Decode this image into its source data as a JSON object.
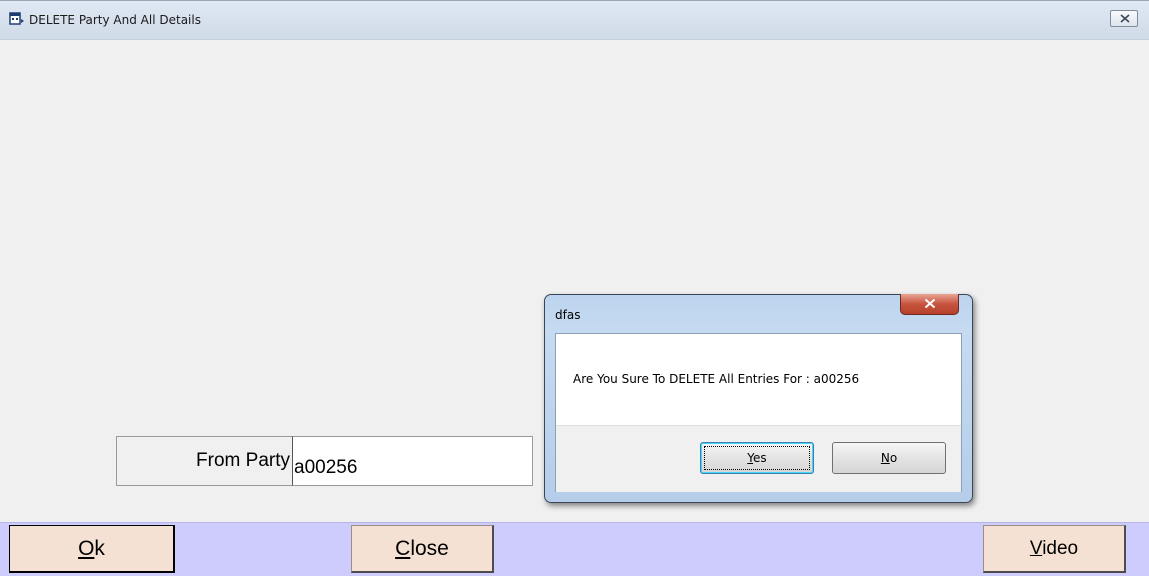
{
  "window": {
    "title": "DELETE Party And All Details"
  },
  "form": {
    "from_party_label": "From Party",
    "from_party_value": "a00256"
  },
  "buttons": {
    "ok": {
      "accel": "O",
      "rest": "k"
    },
    "close": {
      "accel": "C",
      "rest": "lose"
    },
    "video": {
      "accel": "V",
      "rest": "ideo"
    }
  },
  "dialog": {
    "title": "dfas",
    "message": "Are You Sure To DELETE All Entries For : a00256",
    "yes": {
      "accel": "Y",
      "rest": "es"
    },
    "no": {
      "accel": "N",
      "rest": "o"
    }
  },
  "icons": {
    "app": "app-window-icon",
    "main_close": "close-icon",
    "dialog_close": "close-icon"
  },
  "colors": {
    "bottom_bar": "#cdccfd",
    "button_face": "#f5e1d3",
    "dialog_close": "#c7543f"
  }
}
